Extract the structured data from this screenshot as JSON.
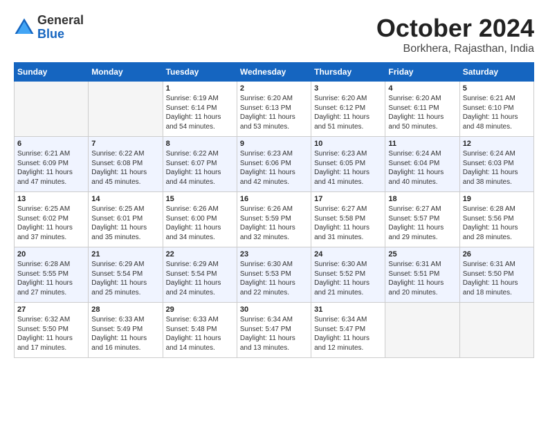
{
  "logo": {
    "general": "General",
    "blue": "Blue"
  },
  "title": "October 2024",
  "subtitle": "Borkhera, Rajasthan, India",
  "weekdays": [
    "Sunday",
    "Monday",
    "Tuesday",
    "Wednesday",
    "Thursday",
    "Friday",
    "Saturday"
  ],
  "weeks": [
    [
      {
        "day": "",
        "info": ""
      },
      {
        "day": "",
        "info": ""
      },
      {
        "day": "1",
        "info": "Sunrise: 6:19 AM\nSunset: 6:14 PM\nDaylight: 11 hours and 54 minutes."
      },
      {
        "day": "2",
        "info": "Sunrise: 6:20 AM\nSunset: 6:13 PM\nDaylight: 11 hours and 53 minutes."
      },
      {
        "day": "3",
        "info": "Sunrise: 6:20 AM\nSunset: 6:12 PM\nDaylight: 11 hours and 51 minutes."
      },
      {
        "day": "4",
        "info": "Sunrise: 6:20 AM\nSunset: 6:11 PM\nDaylight: 11 hours and 50 minutes."
      },
      {
        "day": "5",
        "info": "Sunrise: 6:21 AM\nSunset: 6:10 PM\nDaylight: 11 hours and 48 minutes."
      }
    ],
    [
      {
        "day": "6",
        "info": "Sunrise: 6:21 AM\nSunset: 6:09 PM\nDaylight: 11 hours and 47 minutes."
      },
      {
        "day": "7",
        "info": "Sunrise: 6:22 AM\nSunset: 6:08 PM\nDaylight: 11 hours and 45 minutes."
      },
      {
        "day": "8",
        "info": "Sunrise: 6:22 AM\nSunset: 6:07 PM\nDaylight: 11 hours and 44 minutes."
      },
      {
        "day": "9",
        "info": "Sunrise: 6:23 AM\nSunset: 6:06 PM\nDaylight: 11 hours and 42 minutes."
      },
      {
        "day": "10",
        "info": "Sunrise: 6:23 AM\nSunset: 6:05 PM\nDaylight: 11 hours and 41 minutes."
      },
      {
        "day": "11",
        "info": "Sunrise: 6:24 AM\nSunset: 6:04 PM\nDaylight: 11 hours and 40 minutes."
      },
      {
        "day": "12",
        "info": "Sunrise: 6:24 AM\nSunset: 6:03 PM\nDaylight: 11 hours and 38 minutes."
      }
    ],
    [
      {
        "day": "13",
        "info": "Sunrise: 6:25 AM\nSunset: 6:02 PM\nDaylight: 11 hours and 37 minutes."
      },
      {
        "day": "14",
        "info": "Sunrise: 6:25 AM\nSunset: 6:01 PM\nDaylight: 11 hours and 35 minutes."
      },
      {
        "day": "15",
        "info": "Sunrise: 6:26 AM\nSunset: 6:00 PM\nDaylight: 11 hours and 34 minutes."
      },
      {
        "day": "16",
        "info": "Sunrise: 6:26 AM\nSunset: 5:59 PM\nDaylight: 11 hours and 32 minutes."
      },
      {
        "day": "17",
        "info": "Sunrise: 6:27 AM\nSunset: 5:58 PM\nDaylight: 11 hours and 31 minutes."
      },
      {
        "day": "18",
        "info": "Sunrise: 6:27 AM\nSunset: 5:57 PM\nDaylight: 11 hours and 29 minutes."
      },
      {
        "day": "19",
        "info": "Sunrise: 6:28 AM\nSunset: 5:56 PM\nDaylight: 11 hours and 28 minutes."
      }
    ],
    [
      {
        "day": "20",
        "info": "Sunrise: 6:28 AM\nSunset: 5:55 PM\nDaylight: 11 hours and 27 minutes."
      },
      {
        "day": "21",
        "info": "Sunrise: 6:29 AM\nSunset: 5:54 PM\nDaylight: 11 hours and 25 minutes."
      },
      {
        "day": "22",
        "info": "Sunrise: 6:29 AM\nSunset: 5:54 PM\nDaylight: 11 hours and 24 minutes."
      },
      {
        "day": "23",
        "info": "Sunrise: 6:30 AM\nSunset: 5:53 PM\nDaylight: 11 hours and 22 minutes."
      },
      {
        "day": "24",
        "info": "Sunrise: 6:30 AM\nSunset: 5:52 PM\nDaylight: 11 hours and 21 minutes."
      },
      {
        "day": "25",
        "info": "Sunrise: 6:31 AM\nSunset: 5:51 PM\nDaylight: 11 hours and 20 minutes."
      },
      {
        "day": "26",
        "info": "Sunrise: 6:31 AM\nSunset: 5:50 PM\nDaylight: 11 hours and 18 minutes."
      }
    ],
    [
      {
        "day": "27",
        "info": "Sunrise: 6:32 AM\nSunset: 5:50 PM\nDaylight: 11 hours and 17 minutes."
      },
      {
        "day": "28",
        "info": "Sunrise: 6:33 AM\nSunset: 5:49 PM\nDaylight: 11 hours and 16 minutes."
      },
      {
        "day": "29",
        "info": "Sunrise: 6:33 AM\nSunset: 5:48 PM\nDaylight: 11 hours and 14 minutes."
      },
      {
        "day": "30",
        "info": "Sunrise: 6:34 AM\nSunset: 5:47 PM\nDaylight: 11 hours and 13 minutes."
      },
      {
        "day": "31",
        "info": "Sunrise: 6:34 AM\nSunset: 5:47 PM\nDaylight: 11 hours and 12 minutes."
      },
      {
        "day": "",
        "info": ""
      },
      {
        "day": "",
        "info": ""
      }
    ]
  ]
}
